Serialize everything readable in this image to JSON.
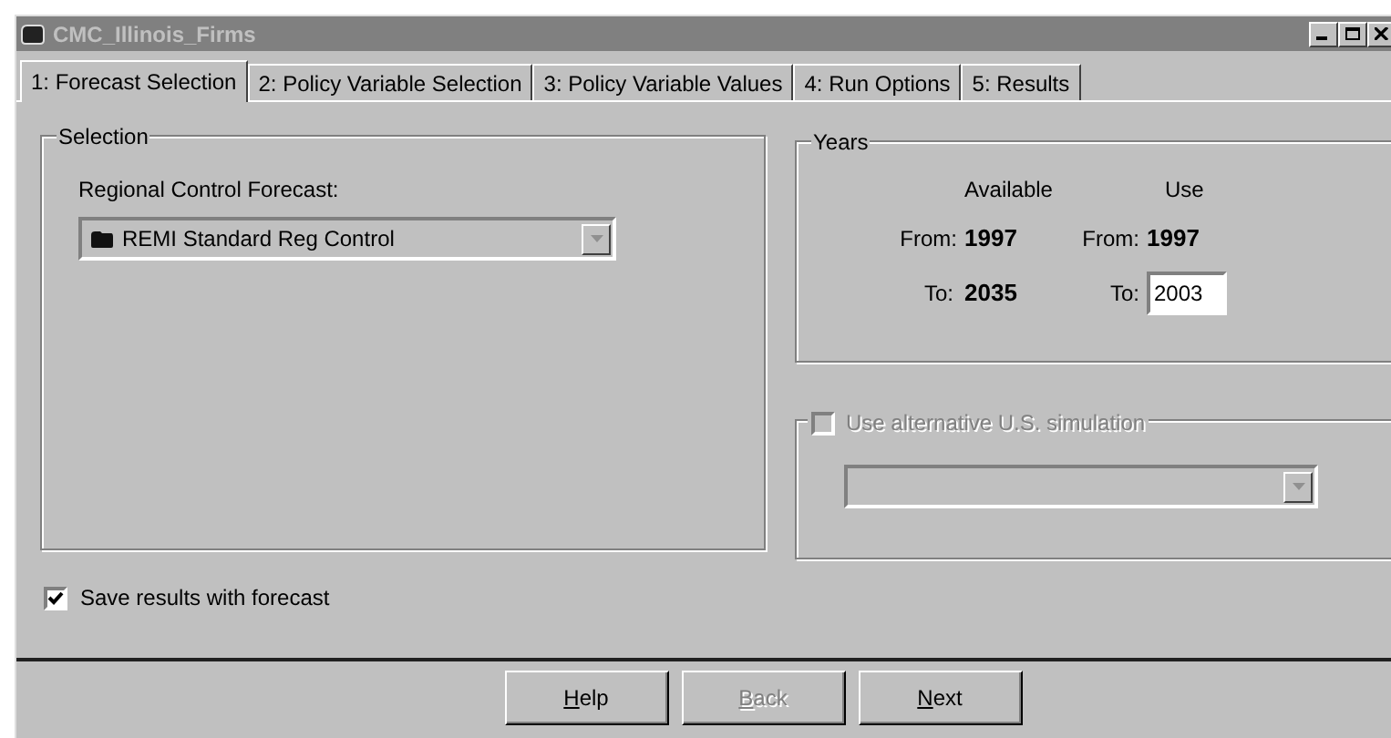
{
  "window": {
    "title": "CMC_Illinois_Firms",
    "active": false
  },
  "tabs": [
    {
      "label": "1: Forecast Selection",
      "selected": true
    },
    {
      "label": "2: Policy Variable Selection",
      "selected": false
    },
    {
      "label": "3: Policy Variable Values",
      "selected": false
    },
    {
      "label": "4: Run Options",
      "selected": false
    },
    {
      "label": "5: Results",
      "selected": false
    }
  ],
  "selection": {
    "title": "Selection",
    "label": "Regional Control Forecast:",
    "value": "REMI Standard Reg Control"
  },
  "years": {
    "title": "Years",
    "available_header": "Available",
    "use_header": "Use",
    "available_from_label": "From:",
    "available_from": "1997",
    "use_from_label": "From:",
    "use_from": "1997",
    "available_to_label": "To:",
    "available_to": "2035",
    "use_to_label": "To:",
    "use_to": "2003"
  },
  "alternative": {
    "label": "Use alternative U.S. simulation",
    "checked": false,
    "disabled": true
  },
  "save_results": {
    "label": "Save results with forecast",
    "checked": true
  },
  "buttons": [
    {
      "label": "Help",
      "disabled": false,
      "mnemonic_first": true
    },
    {
      "label": "Back",
      "disabled": true,
      "mnemonic_first": true
    },
    {
      "label": "Next",
      "disabled": false,
      "mnemonic_first": true
    }
  ]
}
